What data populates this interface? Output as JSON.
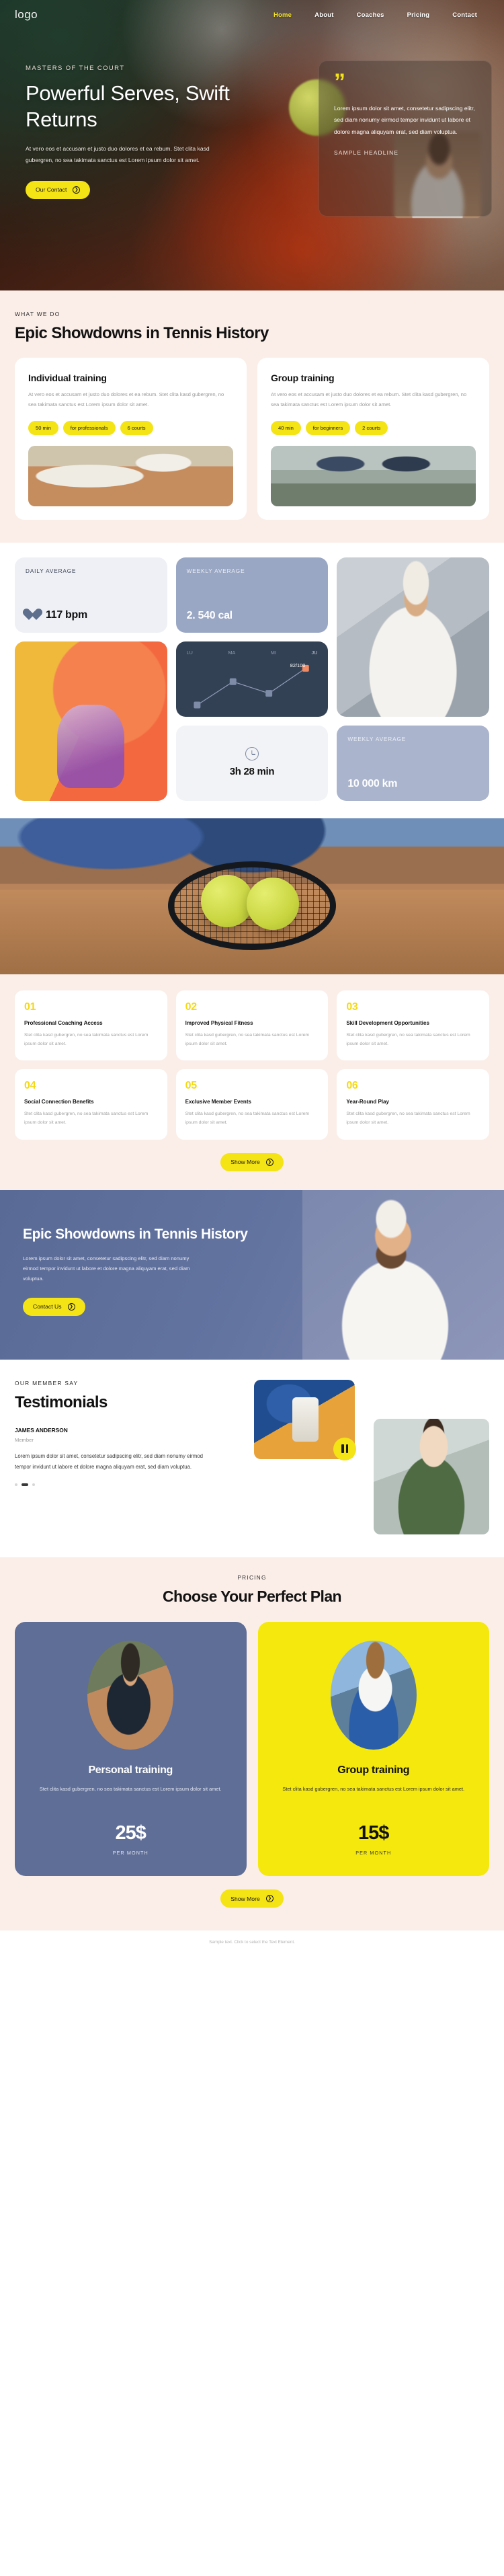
{
  "nav": {
    "logo": "logo",
    "links": [
      {
        "label": "Home",
        "active": true
      },
      {
        "label": "About",
        "active": false
      },
      {
        "label": "Coaches",
        "active": false
      },
      {
        "label": "Pricing",
        "active": false
      },
      {
        "label": "Contact",
        "active": false
      }
    ]
  },
  "hero": {
    "eyebrow": "MASTERS OF THE COURT",
    "title": "Powerful Serves, Swift Returns",
    "desc": "At vero eos et accusam et justo duo dolores et ea rebum. Stet clita kasd gubergren, no sea takimata sanctus est Lorem ipsum dolor sit amet.",
    "cta": "Our Contact",
    "quote_mark": "”",
    "quote_text": "Lorem ipsum dolor sit amet, consetetur sadipscing elitr, sed diam nonumy eirmod tempor invidunt ut labore et dolore magna aliquyam erat, sed diam voluptua.",
    "quote_name": "SAMPLE HEADLINE"
  },
  "what_we_do": {
    "kicker": "WHAT WE DO",
    "heading": "Epic Showdowns in Tennis History",
    "cards": [
      {
        "title": "Individual training",
        "desc": "At vero eos et accusam et justo duo dolores et ea rebum. Stet clita kasd gubergren, no sea takimata sanctus est Lorem ipsum dolor sit amet.",
        "pills": [
          "50 min",
          "for professionals",
          "6 courts"
        ]
      },
      {
        "title": "Group training",
        "desc": "At vero eos et accusam et justo duo dolores et ea rebum. Stet clita kasd gubergren, no sea takimata sanctus est Lorem ipsum dolor sit amet.",
        "pills": [
          "40 min",
          "for beginners",
          "2 courts"
        ]
      }
    ]
  },
  "stats": {
    "daily_average_label": "DAILY AVERAGE",
    "daily_average_value": "117 bpm",
    "weekly_average_label": "WEEKLY AVERAGE",
    "weekly_average_value": "2. 540 cal",
    "time_value": "3h 28 min",
    "distance_label": "WEEKLY AVERAGE",
    "distance_value": "10 000 km"
  },
  "chart_data": {
    "type": "line",
    "title": "",
    "categories": [
      "LU",
      "MA",
      "MI",
      "JU"
    ],
    "values": [
      18,
      58,
      34,
      82
    ],
    "data_label": "82/100",
    "ylim": [
      0,
      100
    ],
    "xlabel": "",
    "ylabel": "",
    "grid": false,
    "legend": "none",
    "marker_color": "#7f8ca8",
    "highlight_color": "#f08a62"
  },
  "features": {
    "items": [
      {
        "num": "01",
        "title": "Professional Coaching Access",
        "desc": "Stet clita kasd gubergren, no sea takimata sanctus est Lorem ipsum dolor sit amet."
      },
      {
        "num": "02",
        "title": "Improved Physical Fitness",
        "desc": "Stet clita kasd gubergren, no sea takimata sanctus est Lorem ipsum dolor sit amet."
      },
      {
        "num": "03",
        "title": "Skill Development Opportunities",
        "desc": "Stet clita kasd gubergren, no sea takimata sanctus est Lorem ipsum dolor sit amet."
      },
      {
        "num": "04",
        "title": "Social Connection Benefits",
        "desc": "Stet clita kasd gubergren, no sea takimata sanctus est Lorem ipsum dolor sit amet."
      },
      {
        "num": "05",
        "title": "Exclusive Member Events",
        "desc": "Stet clita kasd gubergren, no sea takimata sanctus est Lorem ipsum dolor sit amet."
      },
      {
        "num": "06",
        "title": "Year-Round Play",
        "desc": "Stet clita kasd gubergren, no sea takimata sanctus est Lorem ipsum dolor sit amet."
      }
    ],
    "show_more": "Show More"
  },
  "cta_blue": {
    "title": "Epic Showdowns in Tennis History",
    "desc": "Lorem ipsum dolor sit amet, consetetur sadipscing elitr, sed diam nonumy eirmod tempor invidunt ut labore et dolore magna aliquyam erat, sed diam voluptua.",
    "button": "Contact Us"
  },
  "testimonials": {
    "kicker": "OUR MEMBER SAY",
    "heading": "Testimonials",
    "name": "JAMES ANDERSON",
    "role": "Member",
    "text": "Lorem ipsum dolor sit amet, consetetur sadipscing elitr, sed diam nonumy eirmod tempor invidunt ut labore et dolore magna aliquyam erat, sed diam voluptua."
  },
  "pricing": {
    "kicker": "PRICING",
    "heading": "Choose Your Perfect Plan",
    "plans": [
      {
        "title": "Personal training",
        "desc": "Stet clita kasd gubergren, no sea takimata sanctus est Lorem ipsum dolor sit amet.",
        "price": "25$",
        "period": "PER MONTH"
      },
      {
        "title": "Group training",
        "desc": "Stet clita kasd gubergren, no sea takimata sanctus est Lorem ipsum dolor sit amet.",
        "price": "15$",
        "period": "PER MONTH"
      }
    ],
    "show_more": "Show More"
  },
  "footer": {
    "text": "Sample text. Click to select the Text Element."
  },
  "colors": {
    "yellow": "#f4e315",
    "cream": "#fbeee8",
    "blue": "#5f6e97",
    "dark": "#334155"
  }
}
